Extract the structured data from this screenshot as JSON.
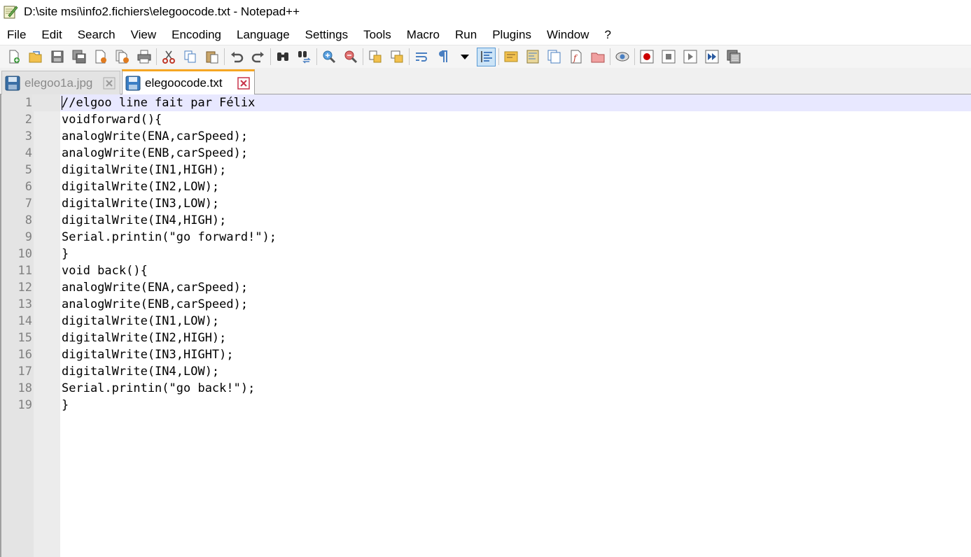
{
  "window": {
    "title": "D:\\site msi\\info2.fichiers\\elegoocode.txt - Notepad++",
    "icon": "notepad-plus-plus-icon"
  },
  "menu": [
    {
      "label": "File"
    },
    {
      "label": "Edit"
    },
    {
      "label": "Search"
    },
    {
      "label": "View"
    },
    {
      "label": "Encoding"
    },
    {
      "label": "Language"
    },
    {
      "label": "Settings"
    },
    {
      "label": "Tools"
    },
    {
      "label": "Macro"
    },
    {
      "label": "Run"
    },
    {
      "label": "Plugins"
    },
    {
      "label": "Window"
    },
    {
      "label": "?"
    }
  ],
  "toolbar": {
    "icons": [
      "new-file-icon",
      "open-file-icon",
      "save-icon",
      "save-all-icon",
      "close-icon",
      "close-all-icon",
      "print-icon",
      "cut-icon",
      "copy-icon",
      "paste-icon",
      "undo-icon",
      "redo-icon",
      "find-icon",
      "replace-icon",
      "zoom-in-icon",
      "zoom-out-icon",
      "sync-vertical-icon",
      "sync-horizontal-icon",
      "word-wrap-icon",
      "show-all-characters-icon",
      "dropdown-arrow-icon",
      "indent-guide-icon",
      "user-defined-language-icon",
      "document-map-icon",
      "document-list-icon",
      "function-list-icon",
      "folder-as-workspace-icon",
      "monitoring-icon",
      "record-macro-icon",
      "stop-recording-icon",
      "playback-macro-icon",
      "run-macro-multiple-icon",
      "save-macro-icon"
    ]
  },
  "tabs": [
    {
      "label": "elegoo1a.jpg",
      "active": false
    },
    {
      "label": "elegoocode.txt",
      "active": true
    }
  ],
  "editor": {
    "current_line": 1,
    "lines": [
      "//elgoo line fait par Félix",
      "voidforward(){",
      "analogWrite(ENA,carSpeed);",
      "analogWrite(ENB,carSpeed);",
      "digitalWrite(IN1,HIGH);",
      "digitalWrite(IN2,LOW);",
      "digitalWrite(IN3,LOW);",
      "digitalWrite(IN4,HIGH);",
      "Serial.printin(\"go forward!\");",
      "}",
      "void back(){",
      "analogWrite(ENA,carSpeed);",
      "analogWrite(ENB,carSpeed);",
      "digitalWrite(IN1,LOW);",
      "digitalWrite(IN2,HIGH);",
      "digitalWrite(IN3,HIGHT);",
      "digitalWrite(IN4,LOW);",
      "Serial.printin(\"go back!\");",
      "}"
    ],
    "line_numbers": [
      "1",
      "2",
      "3",
      "4",
      "5",
      "6",
      "7",
      "8",
      "9",
      "10",
      "11",
      "12",
      "13",
      "14",
      "15",
      "16",
      "17",
      "18",
      "19"
    ]
  },
  "colors": {
    "current_line_bg": "#e8e8ff",
    "active_tab_accent": "#f5a623",
    "tab_close": "#c8324a"
  }
}
